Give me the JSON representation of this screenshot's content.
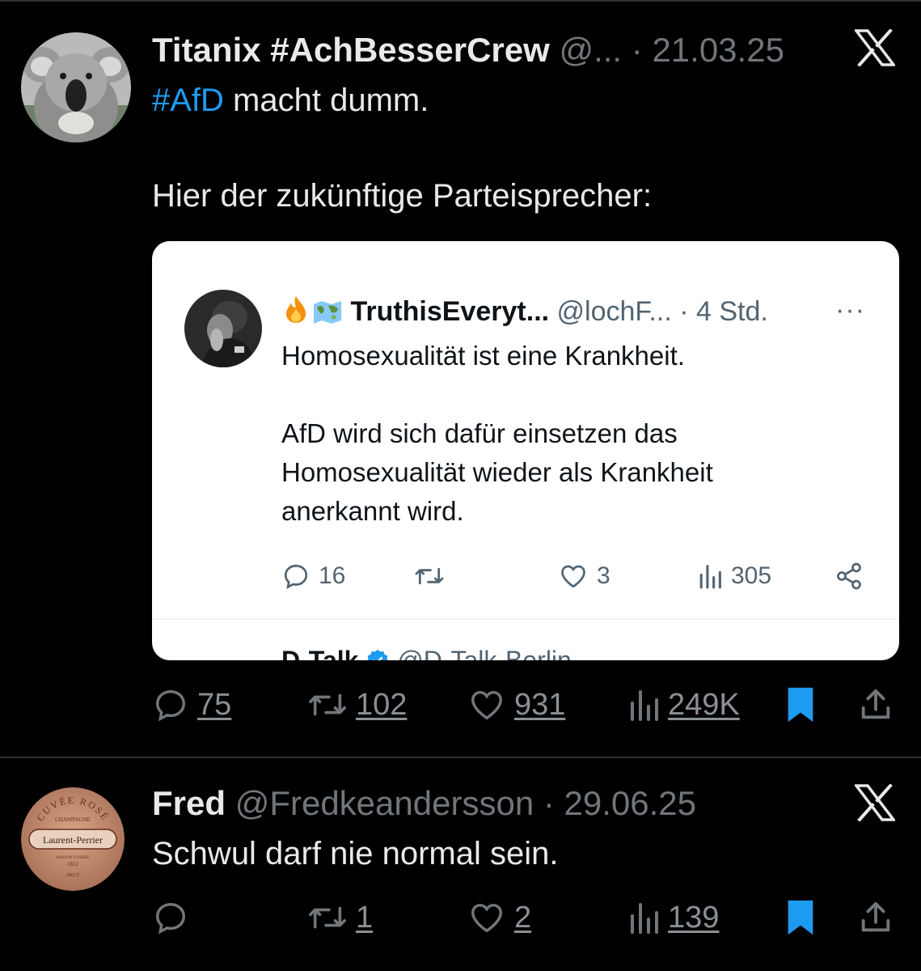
{
  "tweets": [
    {
      "display_name": "Titanix #AchBesserCrew",
      "handle": "@...",
      "separator": " · ",
      "date": "21.03.25",
      "text_hashtag": "#AfD",
      "text_line1_rest": " macht dumm.",
      "text_line2": "Hier der zukünftige Parteisprecher:",
      "stats": {
        "replies": "75",
        "retweets": "102",
        "likes": "931",
        "views": "249K"
      },
      "quoted": {
        "emoji_icons": [
          "fire-emoji",
          "world-map-emoji"
        ],
        "display_name": "TruthisEveryt...",
        "handle": "@lochF...",
        "time": " · 4 Std.",
        "more": "···",
        "lines": [
          "Homosexualität ist eine Krankheit.",
          "",
          "AfD wird sich dafür einsetzen das",
          "Homosexualität wieder als Krankheit",
          "anerkannt wird."
        ],
        "stats": {
          "replies": "16",
          "retweets": "",
          "likes": "3",
          "views": "305"
        },
        "next_reply_name": "D-Talk",
        "next_reply_handle": "@D-Talk-Berlin"
      }
    },
    {
      "display_name": "Fred",
      "handle": "@Fredkeandersson",
      "separator": " · ",
      "date": "29.06.25",
      "text": "Schwul darf nie normal sein.",
      "avatar_text": {
        "top": "CUVÉE ROSÉ",
        "mid1": "CHAMPAGNE",
        "brand": "Laurent-Perrier",
        "mid2": "MAISON FONDÉE",
        "year": "1812",
        "bottom": "BRUT"
      },
      "stats": {
        "replies": "",
        "retweets": "1",
        "likes": "2",
        "views": "139"
      }
    }
  ],
  "colors": {
    "background": "#000000",
    "text": "#e7e9ea",
    "muted": "#71767b",
    "accent": "#1d9bf0"
  }
}
